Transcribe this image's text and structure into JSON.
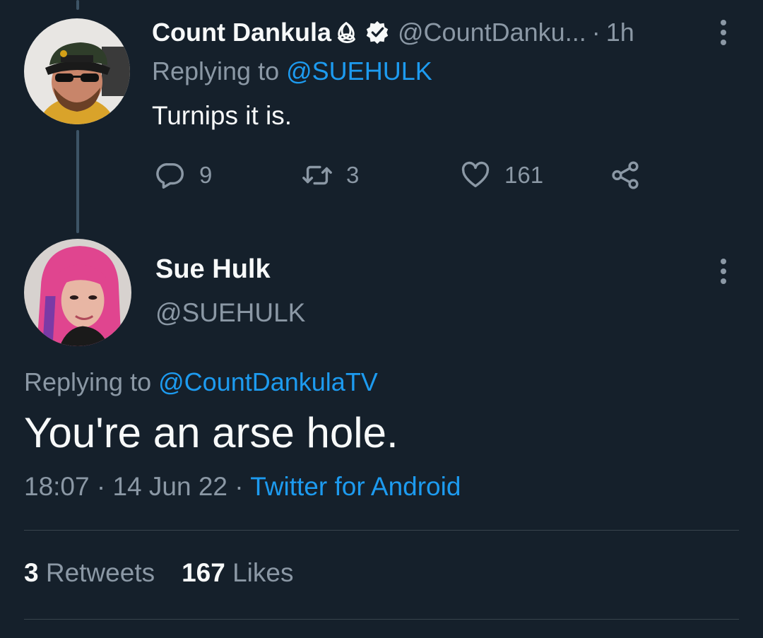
{
  "colors": {
    "background": "#15202b",
    "text_primary": "#f7f9f9",
    "text_secondary": "#8b98a5",
    "accent": "#1d9bf0",
    "divider": "#38444d"
  },
  "parent_tweet": {
    "author_name": "Count Dankula",
    "author_badges": [
      "triquetra-icon",
      "verified-icon"
    ],
    "author_handle": "@CountDanku...",
    "separator": "·",
    "time_ago": "1h",
    "replying_prefix": "Replying to",
    "replying_to": "@SUEHULK",
    "text": "Turnips it is.",
    "actions": {
      "replies": "9",
      "retweets": "3",
      "likes": "161"
    }
  },
  "main_tweet": {
    "author_name": "Sue Hulk",
    "author_handle": "@SUEHULK",
    "replying_prefix": "Replying to",
    "replying_to": "@CountDankulaTV",
    "text": "You're an arse hole.",
    "meta": {
      "time": "18:07",
      "sep1": "·",
      "date": "14 Jun 22",
      "sep2": "·",
      "source": "Twitter for Android"
    },
    "stats": {
      "retweets_count": "3",
      "retweets_label": "Retweets",
      "likes_count": "167",
      "likes_label": "Likes"
    }
  }
}
